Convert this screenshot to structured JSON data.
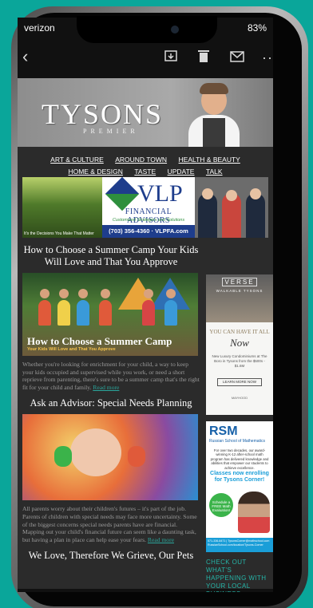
{
  "status_bar": {
    "carrier": "verizon",
    "battery": "83%"
  },
  "mail_toolbar": {
    "icons": [
      "back-chevron-icon",
      "archive-icon",
      "trash-icon",
      "mail-icon",
      "more-icon"
    ]
  },
  "masthead": {
    "logo": "TYSONS",
    "logo_sub": "PREMIER"
  },
  "nav": {
    "items": [
      "ART & CULTURE",
      "AROUND TOWN",
      "HEALTH & BEAUTY",
      "HOME & DESIGN",
      "TASTE",
      "UPDATE",
      "TALK"
    ]
  },
  "ad_banner": {
    "forest_caption": "It's the Decisions You Make That Matter",
    "vlp_name": "VLP",
    "vlp_subtitle": "FINANCIAL ADVISORS",
    "vlp_tagline": "Customized Strategies and Solutions",
    "vlp_phone": "(703) 356-4360 · VLPFA.com"
  },
  "articles": [
    {
      "headline": "How to Choose a Summer Camp Your Kids Will Love and That You Approve",
      "image_title": "How to Choose a Summer Camp",
      "image_subtitle": "Your Kids Will Love and That You Approve",
      "body": "Whether you're looking for enrichment for your child, a way to keep your kids occupied and supervised while you work, or need a short reprieve from parenting, there's sure to be a summer camp that's the right fit for your child and family.",
      "read_more": "Read more"
    },
    {
      "headline": "Ask an Advisor: Special Needs Planning",
      "body": "All parents worry about their children's futures – it's part of the job. Parents of children with special needs may face more uncertainty. Some of the biggest concerns special needs parents have are financial. Mapping out your child's financial future can seem like a daunting task, but having a plan in place can help ease your fears.",
      "read_more": "Read more"
    },
    {
      "headline": "We Love, Therefore We Grieve, Our Pets"
    }
  ],
  "side_ads": {
    "verse": {
      "logo": "VERSE",
      "subtitle": "WALKABLE TYSONS",
      "headline": "YOU CAN HAVE IT ALL",
      "script": "Now",
      "body": "New Luxury Condominiums at The Boro in Tysons from the $500s - $1.6M",
      "button": "LEARN MORE NOW",
      "footer": "MAYHOOD"
    },
    "rsm": {
      "logo": "RSM",
      "name": "Russian School of Mathematics",
      "text": "For over two decades, our award-winning K-12 after-school math program has delivered knowledge and abilities that empower our students to achieve excellence.",
      "enroll": "Classes now enrolling for Tysons Corner!",
      "badge": "Schedule a FREE Math Evaluation!",
      "footer": "571-336-8471 | TysonsCorner@mathschool.com RussianSchool.com/location/Tysons-Corner"
    },
    "check_out": "CHECK OUT WHAT'S HAPPENING WITH YOUR LOCAL BUSINESS ASSOCIATION"
  }
}
